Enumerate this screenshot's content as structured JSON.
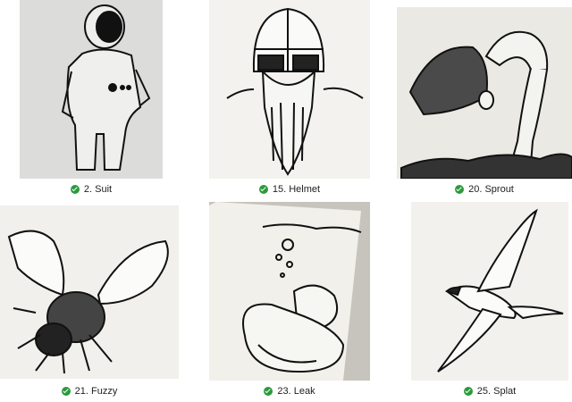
{
  "status_color": "#2b9a3c",
  "items": [
    {
      "label": "2. Suit",
      "subject": "astronaut drawing"
    },
    {
      "label": "15. Helmet",
      "subject": "viking helmet drawing"
    },
    {
      "label": "20. Sprout",
      "subject": "sprout drawing"
    },
    {
      "label": "21. Fuzzy",
      "subject": "bee drawing"
    },
    {
      "label": "23. Leak",
      "subject": "duck drawing"
    },
    {
      "label": "25. Splat",
      "subject": "swallow drawing"
    }
  ]
}
